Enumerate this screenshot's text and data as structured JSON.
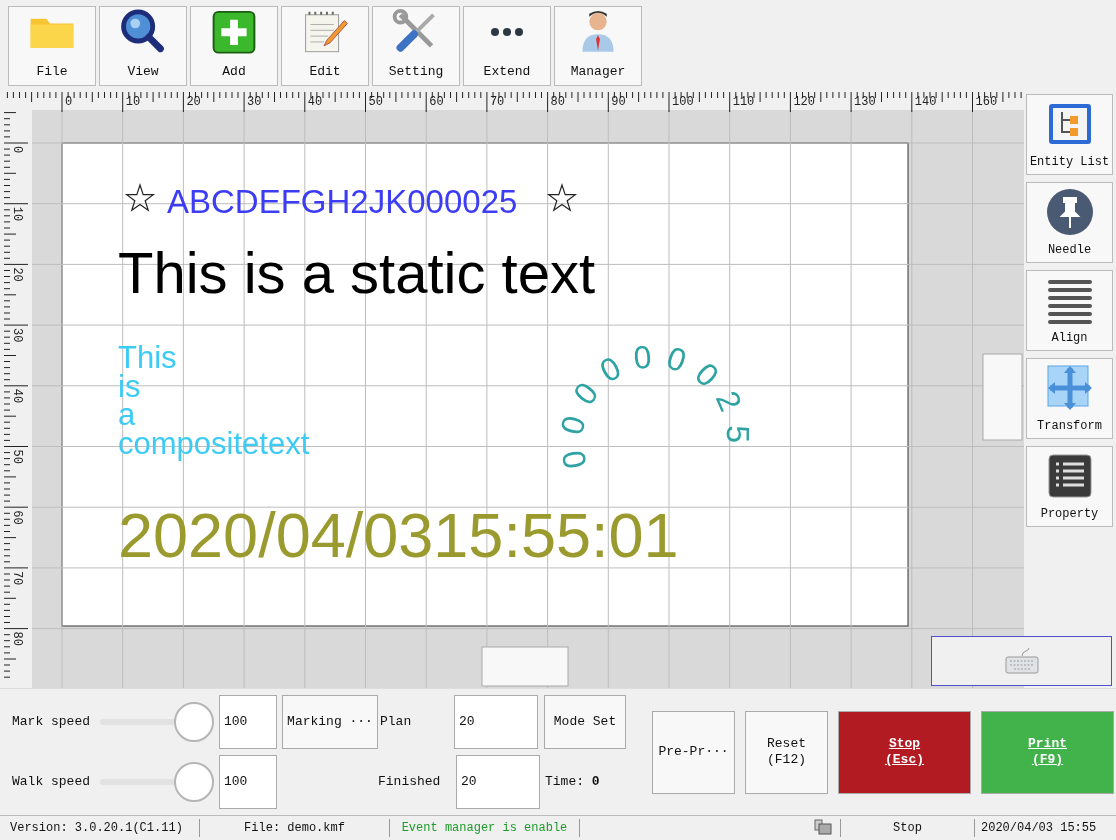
{
  "toolbar": [
    {
      "label": "File",
      "kind": "folder"
    },
    {
      "label": "View",
      "kind": "magnifier"
    },
    {
      "label": "Add",
      "kind": "plus"
    },
    {
      "label": "Edit",
      "kind": "notepad"
    },
    {
      "label": "Setting",
      "kind": "tools"
    },
    {
      "label": "Extend",
      "kind": "dots"
    },
    {
      "label": "Manager",
      "kind": "person"
    }
  ],
  "ruler": {
    "x_labels": [
      "0",
      "10",
      "20",
      "30",
      "40",
      "50",
      "60",
      "70",
      "80",
      "90",
      "100",
      "110",
      "120",
      "130",
      "140",
      "160"
    ],
    "y_labels": [
      "0",
      "10",
      "20",
      "30",
      "40",
      "50",
      "60",
      "70",
      "80"
    ]
  },
  "canvas": {
    "entities": [
      {
        "kind": "star_text",
        "text": "ABCDEFGH2JK000025",
        "color": "#3c3cf5"
      },
      {
        "kind": "dotted",
        "text": "This is a static text",
        "color": "#000000"
      },
      {
        "kind": "composite",
        "lines": [
          "This",
          "is",
          "a",
          "compositetext"
        ],
        "color": "#3ccbf5"
      },
      {
        "kind": "arc",
        "text": "000000025",
        "color": "#2fa3a3"
      },
      {
        "kind": "outline",
        "text": "2020/04/0315:55:01",
        "color": "#9a9a2e"
      }
    ]
  },
  "side_tools": [
    {
      "label": "Entity List",
      "kind": "tree"
    },
    {
      "label": "Needle",
      "kind": "pin"
    },
    {
      "label": "Align",
      "kind": "lines"
    },
    {
      "label": "Transform",
      "kind": "move"
    },
    {
      "label": "Property",
      "kind": "list"
    }
  ],
  "controls": {
    "mark_speed": {
      "label": "Mark speed",
      "level": 1,
      "value": "100"
    },
    "walk_speed": {
      "label": "Walk speed",
      "level": 1,
      "value": "100"
    },
    "marking_button": "Marking ···",
    "plan": {
      "label": "Plan",
      "value": "20"
    },
    "finished": {
      "label": "Finished",
      "value": "20"
    },
    "mode_button": "Mode Set",
    "time": "Time: **0**",
    "actions": [
      {
        "label": "Pre-Pr···",
        "kind": "plain"
      },
      {
        "label": "Reset\n(F12)",
        "kind": "plain"
      },
      {
        "label": "Stop\n(Esc)",
        "kind": "stop"
      },
      {
        "label": "Print\n(F9)",
        "kind": "print"
      }
    ]
  },
  "status_bar": {
    "version": "Version: 3.0.20.1(C1.11)",
    "file": "File: demo.kmf",
    "event": "Event manager is enable",
    "state": "Stop",
    "datetime": "2020/04/03 15:55"
  }
}
